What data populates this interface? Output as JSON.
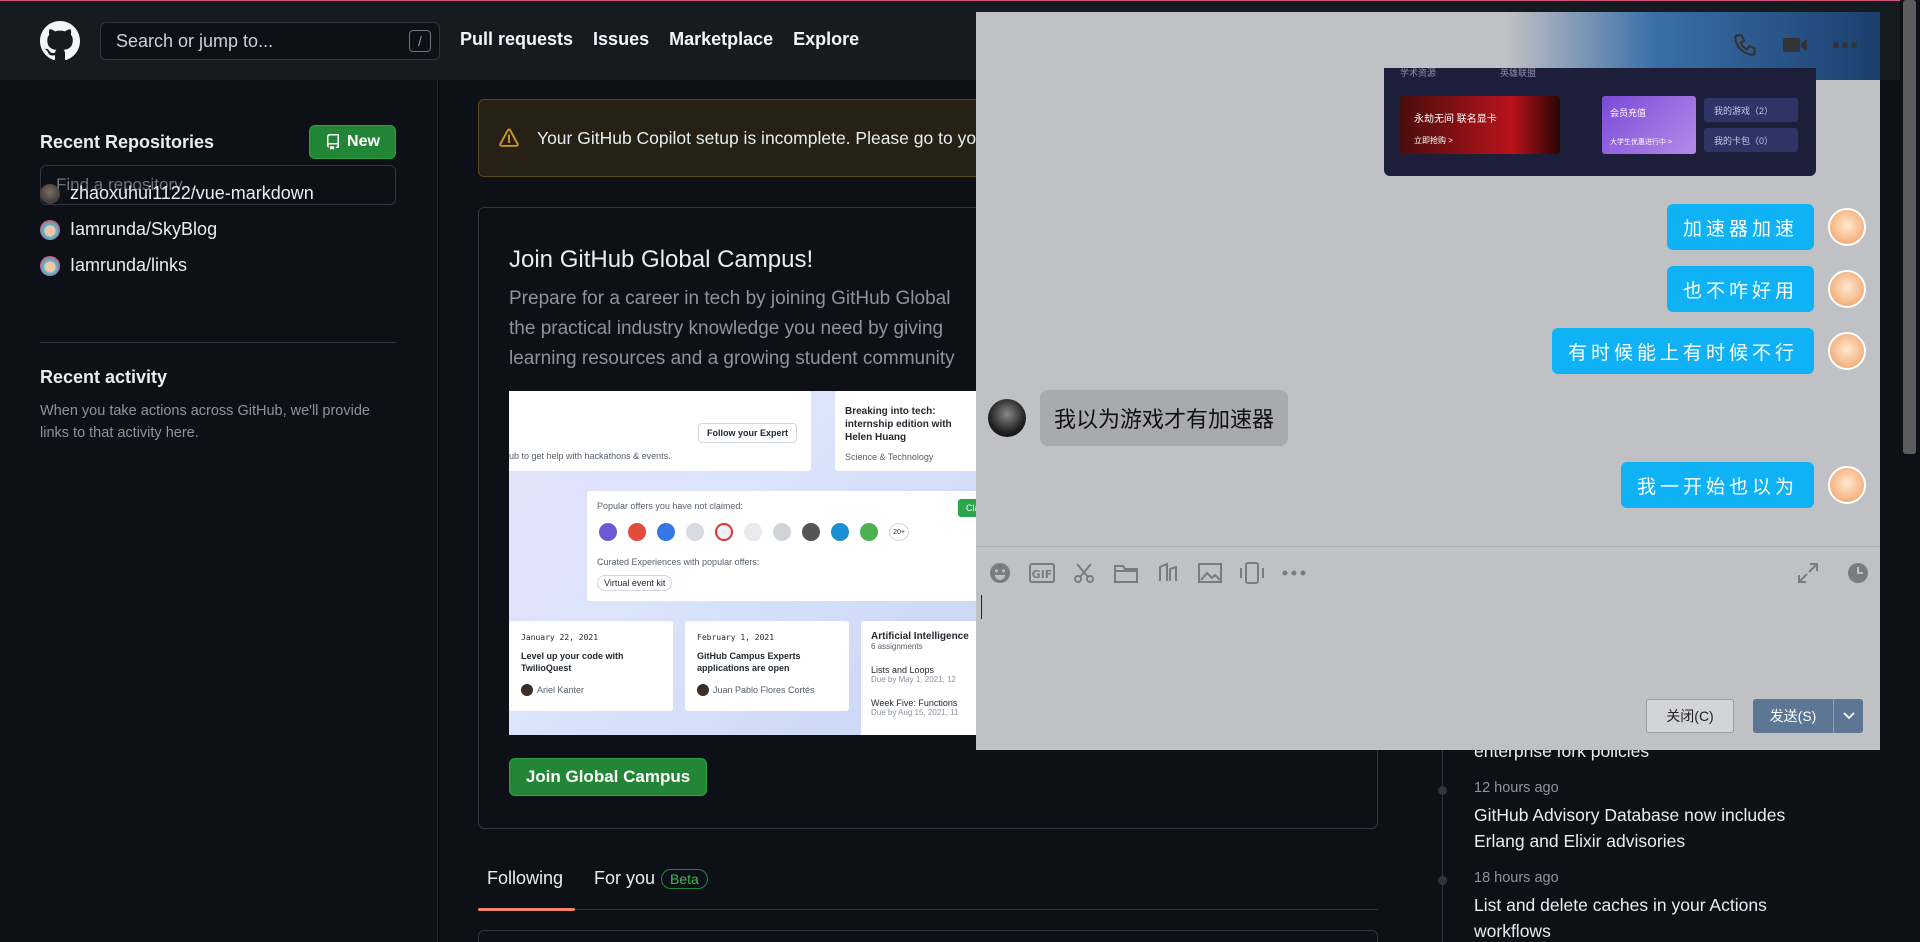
{
  "header": {
    "logo_icon": "github-logo-icon",
    "search_placeholder": "Search or jump to...",
    "search_shortcut": "/",
    "nav": [
      "Pull requests",
      "Issues",
      "Marketplace",
      "Explore"
    ]
  },
  "sidebar": {
    "recent_repos_title": "Recent Repositories",
    "new_button": "New",
    "find_placeholder": "Find a repository...",
    "repos": [
      {
        "name": "zhaoxuhui1122/vue-markdown"
      },
      {
        "name": "Iamrunda/SkyBlog"
      },
      {
        "name": "Iamrunda/links"
      }
    ],
    "recent_activity_title": "Recent activity",
    "recent_activity_text": "When you take actions across GitHub, we'll provide links to that activity here."
  },
  "main": {
    "banner_text": "Your GitHub Copilot setup is incomplete. Please go to yo",
    "campus": {
      "title": "Join GitHub Global Campus!",
      "description_lines": [
        "Prepare for a career in tech by joining GitHub Global",
        "the practical industry knowledge you need by giving",
        "learning resources and a growing student community"
      ],
      "join_button": "Join Global Campus",
      "image": {
        "follow_expert": "Follow your Expert",
        "hub_text": "ub to get help with hackathons & events.",
        "breaking_title": "Breaking into tech: internship edition with Helen Huang",
        "science": "Science & Technology",
        "popular_offers": "Popular offers you have not claimed:",
        "claim": "Claim",
        "more_count": "20+",
        "curated": "Curated Experiences with popular offers:",
        "virtual_event": "Virtual event kit",
        "card1_date": "January 22, 2021",
        "card1_title": "Level up your code with TwilioQuest",
        "card1_author": "Ariel Kanter",
        "card2_date": "February 1, 2021",
        "card2_title": "GitHub Campus Experts applications are open",
        "card2_author": "Juan Pablo Flores Cortés",
        "ai_title": "Artificial Intelligence",
        "ai_sub": "6 assignments",
        "lists_loops": "Lists and Loops",
        "due1": "Due by May 1, 2021, 12",
        "week_five": "Week Five: Functions",
        "due2": "Due by Aug 15, 2021, 11"
      }
    },
    "tabs": {
      "following": "Following",
      "for_you": "For you",
      "beta": "Beta"
    }
  },
  "changelog": [
    {
      "time": "",
      "text": "enterprise fork policies"
    },
    {
      "time": "12 hours ago",
      "text": "GitHub Advisory Database now includes Erlang and Elixir advisories"
    },
    {
      "time": "18 hours ago",
      "text": "List and delete caches in your Actions workflows"
    }
  ],
  "chat": {
    "header_icons": [
      "phone-icon",
      "video-icon",
      "more-icon"
    ],
    "game_card": {
      "tab1": "学术资源",
      "tab2": "英雄联盟",
      "banner1": "永劫无间 联名显卡",
      "banner1_sub": "立即抢购 >",
      "banner2": "会员充值",
      "banner2_sub": "大学生优惠进行中 >",
      "link1": "我的游戏（2）",
      "link2": "我的卡包（0）"
    },
    "messages": [
      {
        "from": "me",
        "text": "加速器加速"
      },
      {
        "from": "me",
        "text": "也不咋好用"
      },
      {
        "from": "me",
        "text": "有时候能上有时候不行"
      },
      {
        "from": "other",
        "text": "我以为游戏才有加速器"
      },
      {
        "from": "me",
        "text": "我一开始也以为"
      }
    ],
    "toolbar_icons": [
      "emoji-icon",
      "gif-icon",
      "scissors-icon",
      "folder-icon",
      "audio-icon",
      "image-icon",
      "shake-icon",
      "more-icon"
    ],
    "close_button": "关闭(C)",
    "send_button": "发送(S)"
  }
}
